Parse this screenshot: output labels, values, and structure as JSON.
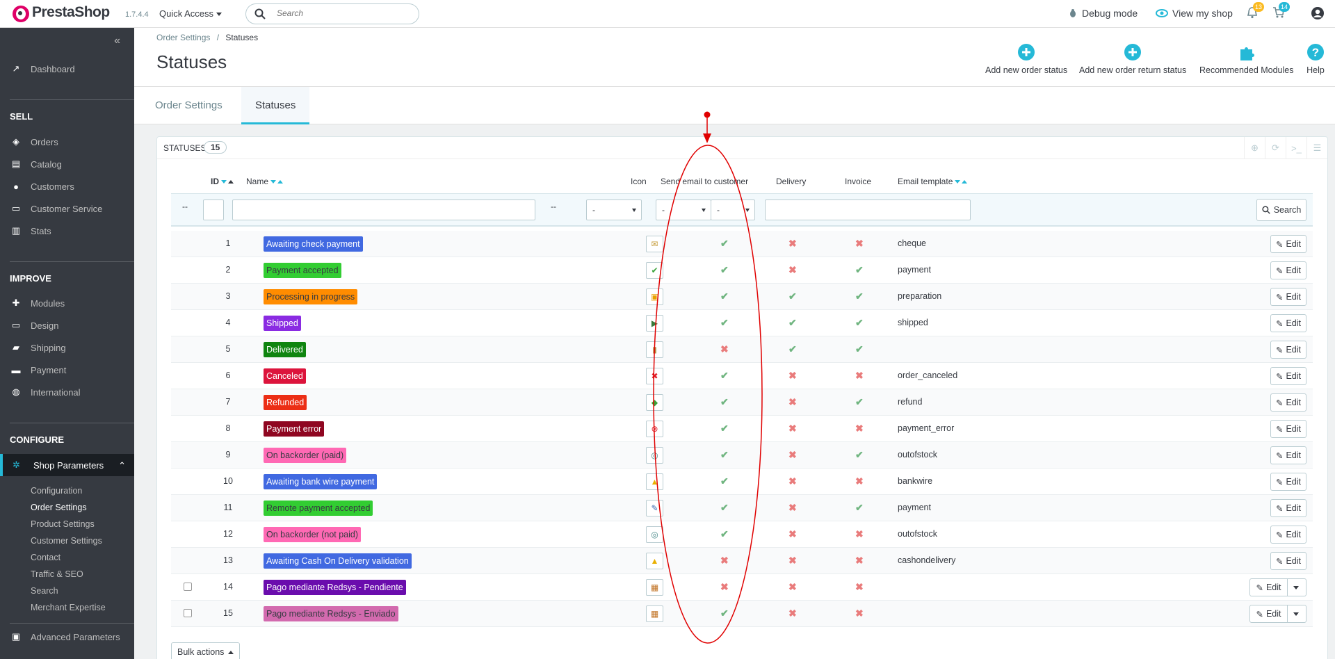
{
  "topbar": {
    "brand": "PrestaShop",
    "version": "1.7.4.4",
    "quick_access": "Quick Access",
    "search_placeholder": "Search",
    "debug_mode": "Debug mode",
    "view_shop": "View my shop",
    "notif_count": "13",
    "orders_count": "14"
  },
  "sidebar": {
    "dashboard": "Dashboard",
    "sections": [
      {
        "title": "SELL",
        "items": [
          "Orders",
          "Catalog",
          "Customers",
          "Customer Service",
          "Stats"
        ]
      },
      {
        "title": "IMPROVE",
        "items": [
          "Modules",
          "Design",
          "Shipping",
          "Payment",
          "International"
        ]
      },
      {
        "title": "CONFIGURE"
      }
    ],
    "active": "Shop Parameters",
    "submenu": [
      "Configuration",
      "Order Settings",
      "Product Settings",
      "Customer Settings",
      "Contact",
      "Traffic & SEO",
      "Search",
      "Merchant Expertise"
    ],
    "advanced": "Advanced Parameters"
  },
  "header": {
    "breadcrumb_parent": "Order Settings",
    "breadcrumb_sep": "/",
    "breadcrumb_current": "Statuses",
    "title": "Statuses",
    "toolbar": {
      "add_order_status": "Add new order status",
      "add_return_status": "Add new order return status",
      "recommended": "Recommended Modules",
      "help": "Help"
    }
  },
  "tabs": [
    "Order Settings",
    "Statuses"
  ],
  "panel": {
    "title": "STATUSES",
    "count": "15",
    "columns": {
      "id": "ID",
      "name": "Name",
      "icon": "Icon",
      "send_email": "Send email to customer",
      "delivery": "Delivery",
      "invoice": "Invoice",
      "template": "Email template"
    },
    "filters": {
      "dash": "--",
      "select_default": "-",
      "search_label": "Search"
    },
    "edit_label": "Edit",
    "bulk_label": "Bulk actions",
    "rows": [
      {
        "id": "1",
        "name": "Awaiting check payment",
        "color": "#4169e1",
        "text": "#ffffff",
        "icon": "check-payment-icon",
        "email": true,
        "delivery": false,
        "invoice": false,
        "template": "cheque",
        "checkbox": false
      },
      {
        "id": "2",
        "name": "Payment accepted",
        "color": "#32cd32",
        "text": "#363a41",
        "icon": "payment-accepted-icon",
        "email": true,
        "delivery": false,
        "invoice": true,
        "template": "payment",
        "checkbox": false
      },
      {
        "id": "3",
        "name": "Processing in progress",
        "color": "#ff8c00",
        "text": "#363a41",
        "icon": "processing-icon",
        "email": true,
        "delivery": true,
        "invoice": true,
        "template": "preparation",
        "checkbox": false
      },
      {
        "id": "4",
        "name": "Shipped",
        "color": "#8a2be2",
        "text": "#ffffff",
        "icon": "shipped-icon",
        "email": true,
        "delivery": true,
        "invoice": true,
        "template": "shipped",
        "checkbox": false
      },
      {
        "id": "5",
        "name": "Delivered",
        "color": "#108510",
        "text": "#ffffff",
        "icon": "delivered-icon",
        "email": false,
        "delivery": true,
        "invoice": true,
        "template": "",
        "checkbox": false
      },
      {
        "id": "6",
        "name": "Canceled",
        "color": "#dc143c",
        "text": "#ffffff",
        "icon": "canceled-icon",
        "email": true,
        "delivery": false,
        "invoice": false,
        "template": "order_canceled",
        "checkbox": false
      },
      {
        "id": "7",
        "name": "Refunded",
        "color": "#ec2e15",
        "text": "#ffffff",
        "icon": "refunded-icon",
        "email": true,
        "delivery": false,
        "invoice": true,
        "template": "refund",
        "checkbox": false
      },
      {
        "id": "8",
        "name": "Payment error",
        "color": "#8f0621",
        "text": "#ffffff",
        "icon": "payment-error-icon",
        "email": true,
        "delivery": false,
        "invoice": false,
        "template": "payment_error",
        "checkbox": false
      },
      {
        "id": "9",
        "name": "On backorder (paid)",
        "color": "#ff69b4",
        "text": "#363a41",
        "icon": "backorder-icon",
        "email": true,
        "delivery": false,
        "invoice": true,
        "template": "outofstock",
        "checkbox": false
      },
      {
        "id": "10",
        "name": "Awaiting bank wire payment",
        "color": "#4169e1",
        "text": "#ffffff",
        "icon": "bank-wire-icon",
        "email": true,
        "delivery": false,
        "invoice": false,
        "template": "bankwire",
        "checkbox": false
      },
      {
        "id": "11",
        "name": "Remote payment accepted",
        "color": "#32cd32",
        "text": "#363a41",
        "icon": "remote-payment-icon",
        "email": true,
        "delivery": false,
        "invoice": true,
        "template": "payment",
        "checkbox": false
      },
      {
        "id": "12",
        "name": "On backorder (not paid)",
        "color": "#ff69b4",
        "text": "#363a41",
        "icon": "backorder-icon",
        "email": true,
        "delivery": false,
        "invoice": false,
        "template": "outofstock",
        "checkbox": false
      },
      {
        "id": "13",
        "name": "Awaiting Cash On Delivery validation",
        "color": "#4169e1",
        "text": "#ffffff",
        "icon": "cash-on-delivery-icon",
        "email": false,
        "delivery": false,
        "invoice": false,
        "template": "cashondelivery",
        "checkbox": false
      },
      {
        "id": "14",
        "name": "Pago mediante Redsys - Pendiente",
        "color": "#6a0dad",
        "text": "#ffffff",
        "icon": "redsys-icon",
        "email": false,
        "delivery": false,
        "invoice": false,
        "template": "",
        "checkbox": true
      },
      {
        "id": "15",
        "name": "Pago mediante Redsys - Enviado",
        "color": "#d26aae",
        "text": "#363a41",
        "icon": "redsys-icon",
        "email": true,
        "delivery": false,
        "invoice": false,
        "template": "",
        "checkbox": true
      }
    ]
  },
  "colors": {
    "accent": "#25b9d7",
    "sidebar_bg": "#363a41",
    "yes": "#70b580",
    "no": "#e97b7b",
    "annotation": "#e00000"
  }
}
